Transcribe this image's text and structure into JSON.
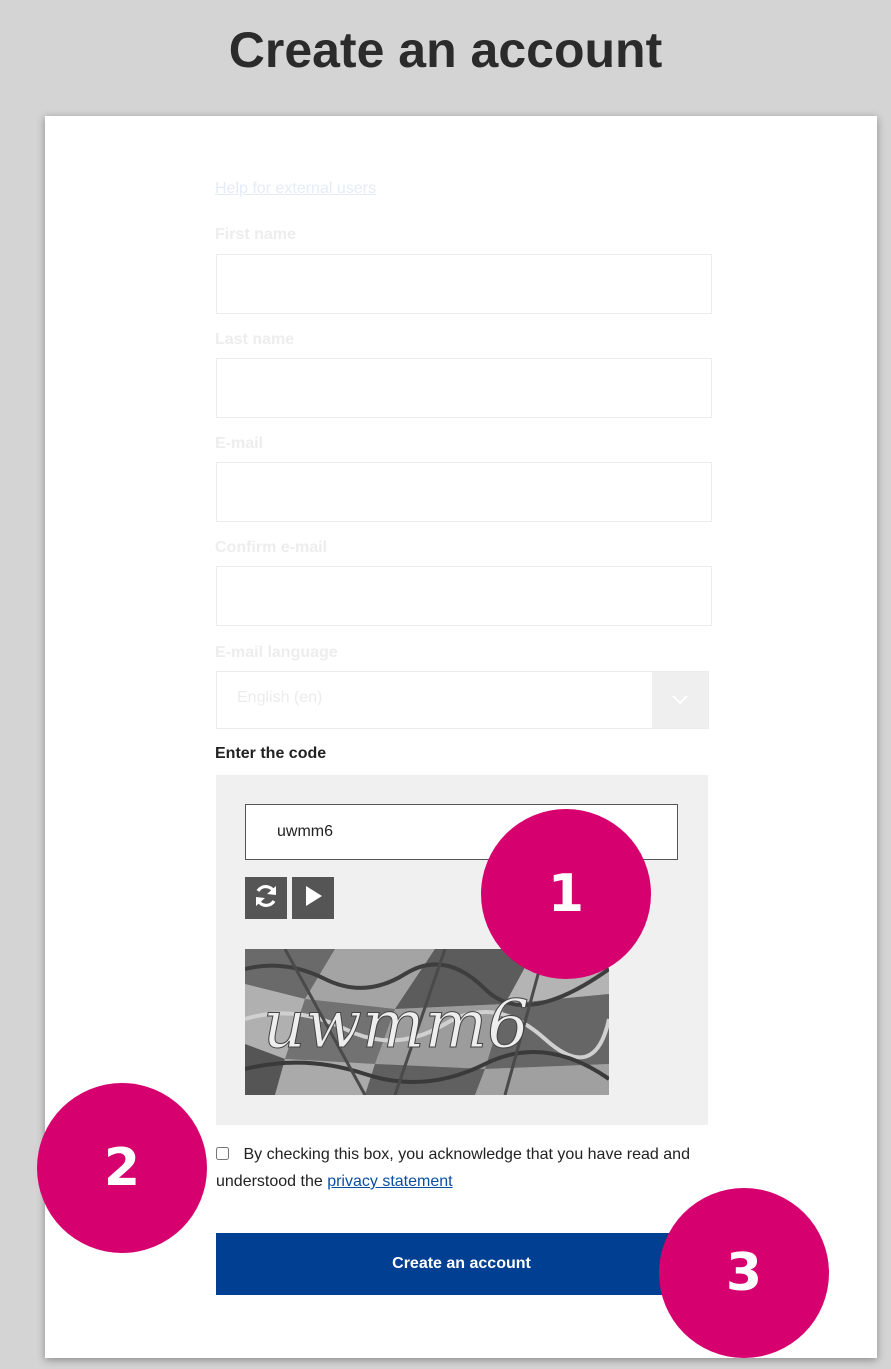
{
  "page": {
    "title": "Create an account"
  },
  "form": {
    "help_link": "Help for external users",
    "first_name_label": "First name",
    "first_name_value": "",
    "last_name_label": "Last name",
    "last_name_value": "",
    "email_label": "E-mail",
    "email_value": "",
    "confirm_email_label": "Confirm e-mail",
    "confirm_email_value": "",
    "email_language_label": "E-mail language",
    "email_language_value": "English (en)"
  },
  "captcha": {
    "label": "Enter the code",
    "input_value": "uwmm6",
    "image_text": "uwmm6",
    "refresh_icon": "refresh-icon",
    "play_icon": "play-icon"
  },
  "consent": {
    "text": "By checking this box, you acknowledge that you have read and understood the",
    "link_text": "privacy statement",
    "checked": false
  },
  "submit": {
    "label": "Create an account"
  },
  "markers": [
    "1",
    "2",
    "3"
  ],
  "colors": {
    "accent": "#003f92",
    "marker": "#d6006f",
    "link": "#0b4fa3"
  }
}
